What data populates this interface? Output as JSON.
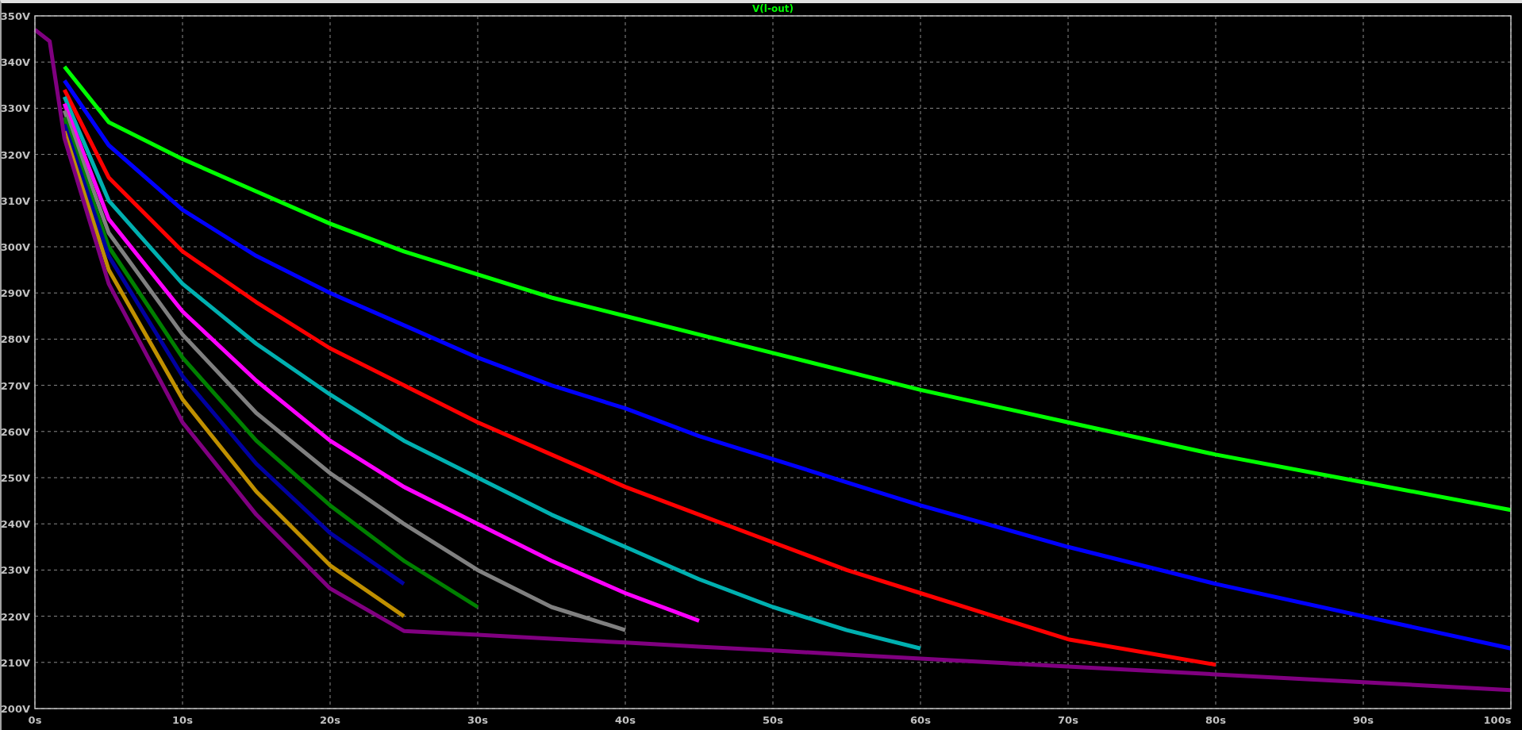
{
  "plot": {
    "chart_data": {
      "type": "line",
      "title": "V(l-out)",
      "grid": true,
      "x": [
        0,
        1,
        2,
        5,
        10,
        15,
        20,
        25,
        30,
        35,
        40,
        45,
        50,
        55,
        60,
        70,
        80,
        90,
        100
      ],
      "series": [
        {
          "color": "#00ff00",
          "values": [
            null,
            null,
            339,
            327,
            319,
            312,
            305,
            299,
            294,
            289,
            285,
            281,
            277,
            273,
            269,
            262,
            255,
            249,
            243
          ]
        },
        {
          "color": "#0000ff",
          "values": [
            null,
            null,
            336,
            322,
            308,
            298,
            290,
            283,
            276,
            270,
            265,
            259,
            254,
            249,
            244,
            235,
            227,
            220,
            213
          ]
        },
        {
          "color": "#ff0000",
          "values": [
            null,
            null,
            334,
            315,
            299,
            288,
            278,
            270,
            262,
            255,
            248,
            242,
            236,
            230,
            225,
            215,
            209.5,
            null,
            null
          ]
        },
        {
          "color": "#00b0b0",
          "values": [
            null,
            null,
            332.5,
            310,
            292,
            279,
            268,
            258,
            250,
            242,
            235,
            228,
            222,
            217,
            213,
            null,
            null,
            null,
            null
          ]
        },
        {
          "color": "#ff00ff",
          "values": [
            null,
            null,
            331,
            306,
            286,
            271,
            258,
            248,
            240,
            232,
            225,
            219,
            null,
            null,
            null,
            null,
            null,
            null,
            null
          ]
        },
        {
          "color": "#808080",
          "values": [
            null,
            null,
            329.5,
            303,
            281,
            264,
            251,
            240,
            230,
            222,
            217,
            null,
            null,
            null,
            null,
            null,
            null,
            null,
            null
          ]
        },
        {
          "color": "#008000",
          "values": [
            null,
            null,
            328,
            300,
            276,
            258,
            244,
            232,
            222,
            null,
            null,
            null,
            null,
            null,
            null,
            null,
            null,
            null,
            null
          ]
        },
        {
          "color": "#0000a0",
          "values": [
            null,
            null,
            326.5,
            298,
            272,
            253,
            238,
            227,
            null,
            null,
            null,
            null,
            null,
            null,
            null,
            null,
            null,
            null,
            null
          ]
        },
        {
          "color": "#c09000",
          "values": [
            null,
            null,
            325,
            295,
            267,
            247,
            231,
            220,
            null,
            null,
            null,
            null,
            null,
            null,
            null,
            null,
            null,
            null,
            null
          ]
        },
        {
          "color": "#800080",
          "values": [
            347,
            344.5,
            323.5,
            292,
            262,
            242,
            226,
            216.8,
            216,
            215.1,
            214.3,
            213.4,
            212.6,
            211.7,
            210.8,
            209.1,
            207.4,
            205.7,
            204
          ]
        }
      ],
      "xlim": [
        0,
        100
      ],
      "ylim": [
        200,
        350
      ],
      "xticks": [
        {
          "value": 0,
          "label": "0s"
        },
        {
          "value": 10,
          "label": "10s"
        },
        {
          "value": 20,
          "label": "20s"
        },
        {
          "value": 30,
          "label": "30s"
        },
        {
          "value": 40,
          "label": "40s"
        },
        {
          "value": 50,
          "label": "50s"
        },
        {
          "value": 60,
          "label": "60s"
        },
        {
          "value": 70,
          "label": "70s"
        },
        {
          "value": 80,
          "label": "80s"
        },
        {
          "value": 90,
          "label": "90s"
        },
        {
          "value": 100,
          "label": "100s"
        }
      ],
      "yticks": [
        {
          "value": 200,
          "label": "200V"
        },
        {
          "value": 210,
          "label": "210V"
        },
        {
          "value": 220,
          "label": "220V"
        },
        {
          "value": 230,
          "label": "230V"
        },
        {
          "value": 240,
          "label": "240V"
        },
        {
          "value": 250,
          "label": "250V"
        },
        {
          "value": 260,
          "label": "260V"
        },
        {
          "value": 270,
          "label": "270V"
        },
        {
          "value": 280,
          "label": "280V"
        },
        {
          "value": 290,
          "label": "290V"
        },
        {
          "value": 300,
          "label": "300V"
        },
        {
          "value": 310,
          "label": "310V"
        },
        {
          "value": 320,
          "label": "320V"
        },
        {
          "value": 330,
          "label": "330V"
        },
        {
          "value": 340,
          "label": "340V"
        },
        {
          "value": 350,
          "label": "350V"
        }
      ]
    }
  }
}
